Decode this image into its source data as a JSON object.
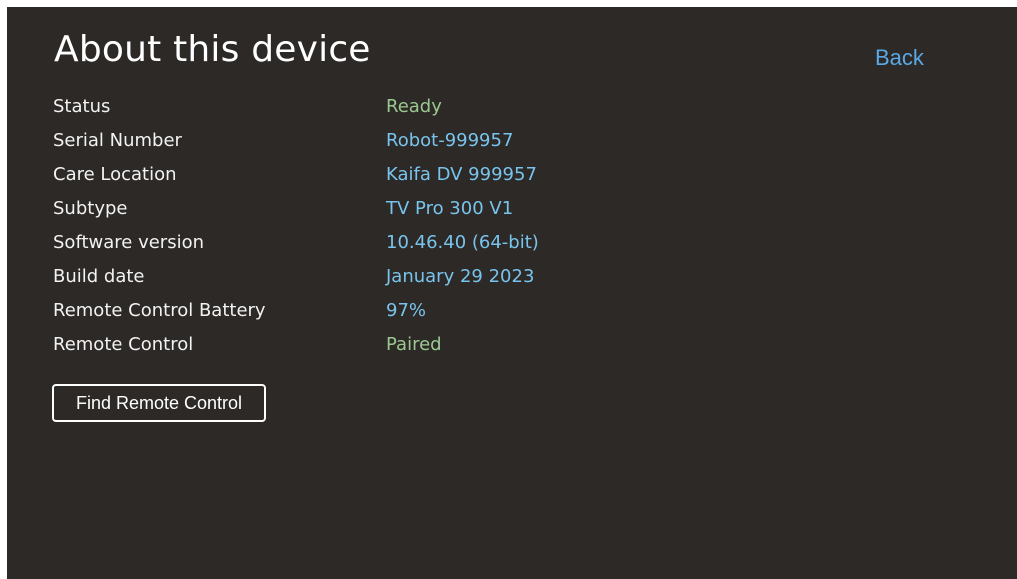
{
  "page": {
    "title": "About this device",
    "back_label": "Back"
  },
  "colors": {
    "background": "#2c2927",
    "status_green": "#9bc891",
    "value_blue": "#79c4ec",
    "link_blue": "#5aa9e6"
  },
  "rows": [
    {
      "label": "Status",
      "value": "Ready",
      "color": "#9bc891"
    },
    {
      "label": "Serial Number",
      "value": "Robot-999957",
      "color": "#79c4ec"
    },
    {
      "label": "Care Location",
      "value": "Kaifa DV 999957",
      "color": "#79c4ec"
    },
    {
      "label": "Subtype",
      "value": "TV Pro 300 V1",
      "color": "#79c4ec"
    },
    {
      "label": "Software version",
      "value": "10.46.40 (64-bit)",
      "color": "#79c4ec"
    },
    {
      "label": "Build date",
      "value": "January 29 2023",
      "color": "#79c4ec"
    },
    {
      "label": "Remote Control Battery",
      "value": "97%",
      "color": "#79c4ec"
    },
    {
      "label": "Remote Control",
      "value": "Paired",
      "color": "#9bc891"
    }
  ],
  "actions": {
    "find_remote_label": "Find Remote Control"
  }
}
